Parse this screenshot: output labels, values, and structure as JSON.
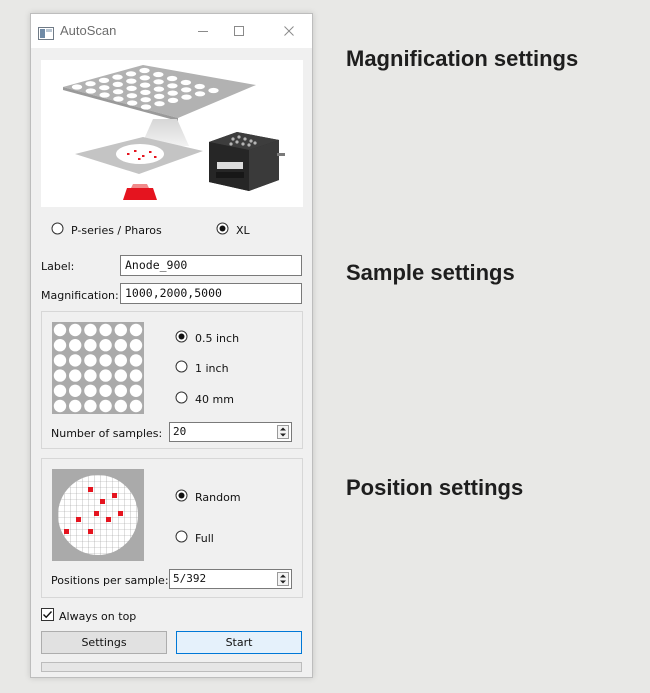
{
  "window": {
    "title": "AutoScan",
    "controls": {
      "minimize": "—",
      "maximize": "☐",
      "close": "✕"
    }
  },
  "device_selection": {
    "options": [
      {
        "label": "P-series / Pharos",
        "selected": false
      },
      {
        "label": "XL",
        "selected": true
      }
    ]
  },
  "fields": {
    "label": {
      "caption": "Label:",
      "value": "Anode_900"
    },
    "magnification": {
      "caption": "Magnification:",
      "value": "1000,2000,5000"
    }
  },
  "sample_group": {
    "sizes": [
      {
        "label": "0.5 inch",
        "selected": true
      },
      {
        "label": "1 inch",
        "selected": false
      },
      {
        "label": "40 mm",
        "selected": false
      }
    ],
    "count_caption": "Number of samples:",
    "count_value": "20"
  },
  "position_group": {
    "modes": [
      {
        "label": "Random",
        "selected": true
      },
      {
        "label": "Full",
        "selected": false
      }
    ],
    "per_sample_caption": "Positions per sample:",
    "per_sample_value": "5/392"
  },
  "options": {
    "always_on_top": {
      "label": "Always on top",
      "checked": true
    }
  },
  "buttons": {
    "settings": "Settings",
    "start": "Start"
  },
  "progress": {
    "value": 0
  },
  "annotations": {
    "magnification": "Magnification settings",
    "sample": "Sample settings",
    "position": "Position settings"
  },
  "colors": {
    "accent_red": "#e5141f",
    "focus_blue": "#0078d7",
    "window_bg": "#f0f0f0"
  }
}
